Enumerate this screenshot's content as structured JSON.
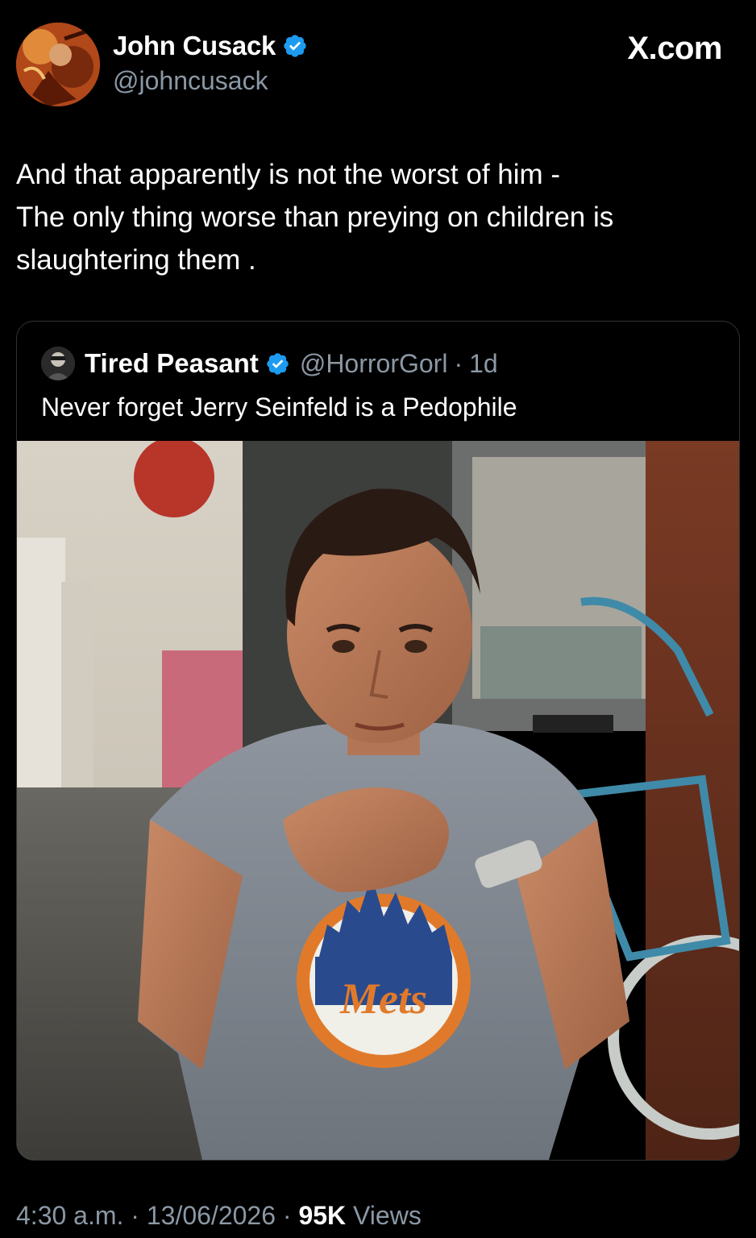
{
  "site": {
    "label": "X.com"
  },
  "tweet": {
    "author": {
      "display_name": "John Cusack",
      "handle": "@johncusack",
      "verified": true,
      "avatar_icon": "avatar-image"
    },
    "text": "And that apparently is not the worst  of him -\nThe only thing worse than preying on children is slaughtering them .",
    "timestamp": {
      "time": "4:30 a.m.",
      "separator": "·",
      "date": "13/06/2026",
      "views_count": "95K",
      "views_label": "Views"
    }
  },
  "quoted_tweet": {
    "author": {
      "display_name": "Tired Peasant",
      "handle": "@HorrorGorl",
      "age": "1d",
      "verified": true
    },
    "separator": "·",
    "text": "Never forget Jerry Seinfeld is a Pedophile",
    "photo_shirt_text": "Mets"
  },
  "colors": {
    "background": "#000000",
    "primary_text": "#ffffff",
    "secondary_text": "#8b98a5",
    "verified_blue": "#1d9bf0",
    "card_border": "#2f3336"
  }
}
